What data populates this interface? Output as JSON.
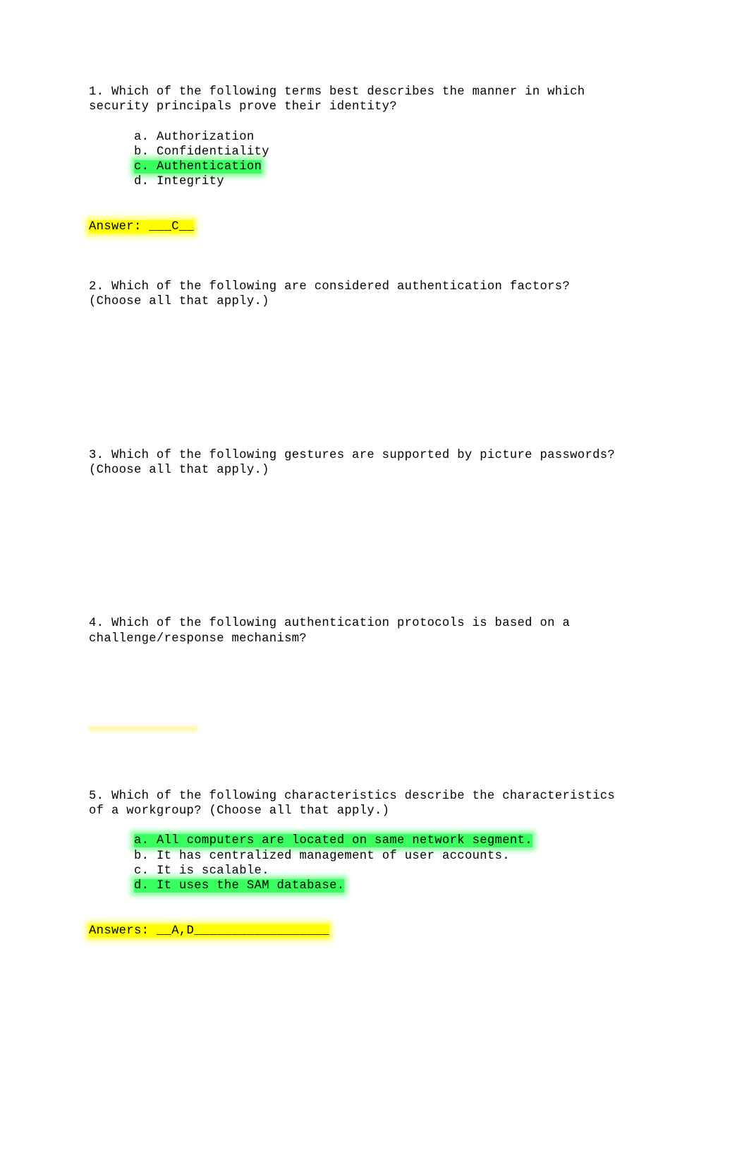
{
  "document": {
    "title": "Security and Networking Review Questions",
    "highlight_colors": {
      "green": "#39ff5f",
      "yellow": "#ffff00"
    }
  },
  "questions": [
    {
      "number": "1.",
      "text": "1. Which of the following terms best describes the manner in which\nsecurity principals prove their identity?",
      "options": [
        {
          "label": "a. Authorization",
          "highlight": "none"
        },
        {
          "label": "b. Confidentiality",
          "highlight": "none"
        },
        {
          "label": "c. Authentication",
          "highlight": "green"
        },
        {
          "label": "d. Integrity",
          "highlight": "none"
        }
      ],
      "answer_label": "Answer: ___C__",
      "answer_highlight": "yellow"
    },
    {
      "number": "2.",
      "text": "2. Which of the following are considered authentication factors?\n(Choose all that apply.)",
      "options": [],
      "answer_label": "",
      "answer_highlight": "none"
    },
    {
      "number": "3.",
      "text": "3. Which of the following gestures are supported by picture passwords?\n(Choose all that apply.)",
      "options": [],
      "answer_label": "",
      "answer_highlight": "none"
    },
    {
      "number": "4.",
      "text": "4. Which of the following authentication protocols is based on a\nchallenge/response mechanism?",
      "options": [],
      "answer_label": "",
      "answer_highlight": "none"
    },
    {
      "number": "5.",
      "text": "5. Which of the following characteristics describe the characteristics\nof a workgroup? (Choose all that apply.)",
      "options": [
        {
          "label": "a. All computers are located on same network segment.",
          "highlight": "green"
        },
        {
          "label": "b. It has centralized management of user accounts.",
          "highlight": "none"
        },
        {
          "label": "c. It is scalable.",
          "highlight": "none"
        },
        {
          "label": "d. It uses the SAM database.",
          "highlight": "green"
        }
      ],
      "answer_label": "Answers: __A,D__________________",
      "answer_highlight": "yellow"
    }
  ]
}
